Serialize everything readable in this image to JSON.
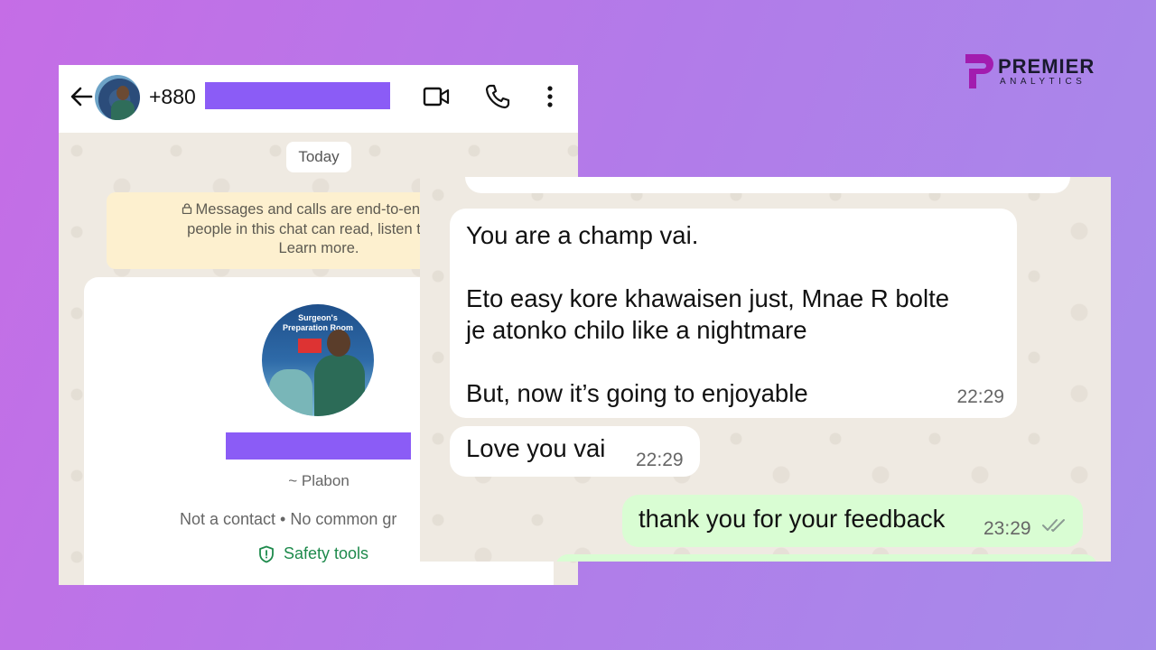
{
  "header": {
    "phone_prefix": "+880",
    "icons": [
      "back-arrow-icon",
      "video-call-icon",
      "phone-call-icon",
      "more-options-icon"
    ]
  },
  "chat_left": {
    "date_chip": "Today",
    "encryption_notice_line1": "Messages and calls are end-to-end enc",
    "encryption_notice_line2": "people in this chat can read, listen to, or",
    "encryption_notice_line3": "Learn more.",
    "profile": {
      "nickname": "~ Plabon",
      "status": "Not a contact • No common gr",
      "safety_tools": "Safety tools",
      "avatar_banner": "Surgeon's Preparation Room"
    }
  },
  "chat_right": {
    "messages": [
      {
        "direction": "incoming",
        "line1": "You are a champ vai.",
        "line2": "Eto easy kore khawaisen just, Mnae R bolte",
        "line3": "je atonko chilo like a nightmare",
        "line4": "But,  now it’s going to enjoyable",
        "time": "22:29"
      },
      {
        "direction": "incoming",
        "text": "Love you vai",
        "time": "22:29"
      },
      {
        "direction": "outgoing",
        "text": "thank you for your feedback",
        "time": "23:29",
        "read_ticks": "double-check-icon"
      }
    ]
  },
  "logo": {
    "name": "PREMIER",
    "sub": "ANALYTICS"
  },
  "colors": {
    "background_start": "#c56de6",
    "background_end": "#a68bea",
    "redaction": "#8b5cf6",
    "outgoing_bubble": "#d9fdd3",
    "safety_green": "#1e8a4c",
    "logo_accent": "#a21caf"
  }
}
